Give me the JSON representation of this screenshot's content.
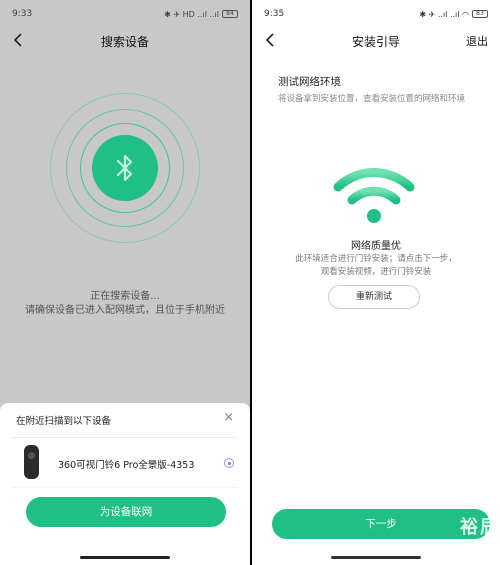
{
  "left": {
    "status": {
      "time": "9:33",
      "icons": "✱ ✈ HD ..ıl ..ıl",
      "battery": "84"
    },
    "nav": {
      "title": "搜索设备"
    },
    "scan": {
      "line1": "正在搜索设备...",
      "line2": "请确保设备已进入配网模式，且位于手机附近"
    },
    "sheet": {
      "header": "在附近扫描到以下设备",
      "close": "×",
      "device_name": "360可视门铃6 Pro全景版-4353",
      "connect_button": "为设备联网"
    }
  },
  "right": {
    "status": {
      "time": "9:35",
      "icons": "✱ ✈ ..ıl ..ıl ◠",
      "battery": "83"
    },
    "nav": {
      "title": "安装引导",
      "exit": "退出"
    },
    "section": {
      "title": "测试网络环境",
      "subtitle": "将设备拿到安装位置，查看安装位置的网络和环境"
    },
    "result": {
      "quality": "网络质量优",
      "desc": "此环境适合进行门铃安装；请点击下一步，观看安装视频，进行门铃安装"
    },
    "retest_button": "重新测试",
    "next_button": "下一步",
    "watermark": "裕辰"
  },
  "colors": {
    "accent": "#1fbf86",
    "background_left": "#c8c8c8"
  }
}
